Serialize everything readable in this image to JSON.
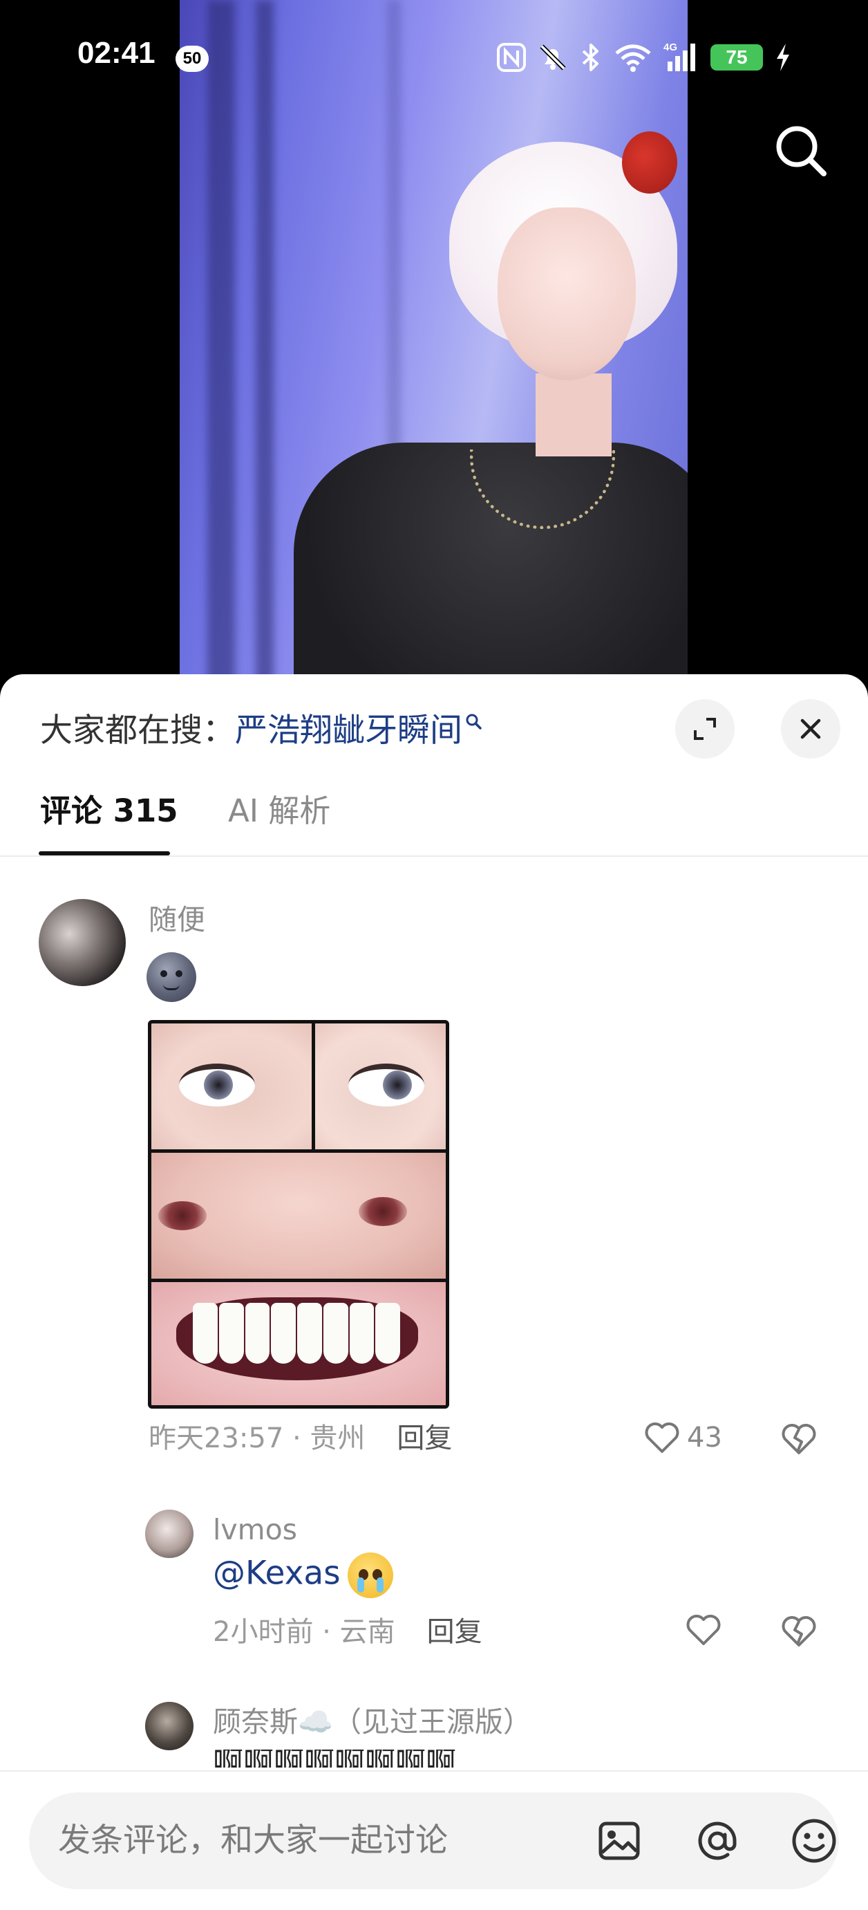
{
  "status_bar": {
    "time": "02:41",
    "notification_count": "50",
    "battery": "75",
    "icons": [
      "nfc-icon",
      "bell-muted-icon",
      "bluetooth-icon",
      "wifi-icon",
      "signal-4g-icon",
      "battery-icon",
      "charging-icon"
    ]
  },
  "video": {
    "search_icon": "search-icon"
  },
  "sheet": {
    "search_prefix": "大家都在搜：",
    "search_term": "严浩翔龇牙瞬间",
    "tabs": [
      {
        "label": "评论 315",
        "active": true
      },
      {
        "label": "AI 解析",
        "active": false
      }
    ]
  },
  "comments": [
    {
      "username": "随便",
      "emoji": "moon-face-emoji",
      "image": "eyes-nose-teeth-collage",
      "time": "昨天23:57 · 贵州",
      "reply_label": "回复",
      "likes": "43"
    }
  ],
  "replies": [
    {
      "username": "lvmos",
      "text": "@Kexas",
      "emoji": "crying-face-emoji",
      "time": "2小时前 · 云南",
      "reply_label": "回复",
      "likes": ""
    },
    {
      "username": "顾奈斯☁️（见过王源版）",
      "partial_text": "啊啊啊啊啊啊啊啊"
    }
  ],
  "input": {
    "placeholder": "发条评论，和大家一起讨论",
    "buttons": [
      "image-icon",
      "at-icon",
      "emoji-icon"
    ]
  },
  "colors": {
    "accent_link": "#1d3d85",
    "battery": "#45c45a",
    "muted_text": "#9a9a9a"
  }
}
